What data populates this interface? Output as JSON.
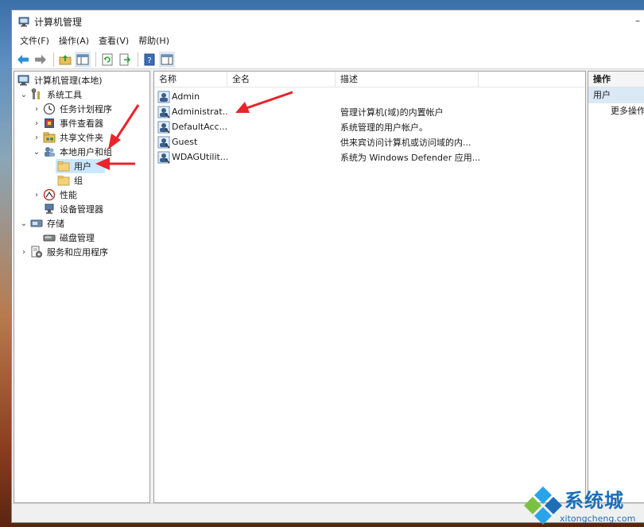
{
  "window": {
    "title": "计算机管理"
  },
  "menu": [
    "文件(F)",
    "操作(A)",
    "查看(V)",
    "帮助(H)"
  ],
  "toolbar": {
    "icons": [
      "back-arrow-icon",
      "forward-arrow-icon",
      "up-folder-icon",
      "show-hide-tree-icon",
      "refresh-icon",
      "export-icon",
      "help-icon",
      "show-action-pane-icon"
    ]
  },
  "tree": {
    "root": "计算机管理(本地)",
    "system_tools": "系统工具",
    "task_scheduler": "任务计划程序",
    "event_viewer": "事件查看器",
    "shared_folders": "共享文件夹",
    "local_users_groups": "本地用户和组",
    "users": "用户",
    "groups": "组",
    "performance": "性能",
    "device_manager": "设备管理器",
    "storage": "存储",
    "disk_management": "磁盘管理",
    "services_apps": "服务和应用程序"
  },
  "list": {
    "columns": [
      "名称",
      "全名",
      "描述"
    ],
    "rows": [
      {
        "name": "Admin",
        "full": "",
        "desc": ""
      },
      {
        "name": "Administrat...",
        "full": "",
        "desc": "管理计算机(域)的内置帐户"
      },
      {
        "name": "DefaultAcc...",
        "full": "",
        "desc": "系统管理的用户帐户。"
      },
      {
        "name": "Guest",
        "full": "",
        "desc": "供来宾访问计算机或访问域的内..."
      },
      {
        "name": "WDAGUtilit...",
        "full": "",
        "desc": "系统为 Windows Defender 应用..."
      }
    ]
  },
  "actions": {
    "header": "操作",
    "section": "用户",
    "more": "更多操作"
  },
  "watermark": {
    "brand": "系统城",
    "site": "xitongcheng.com"
  },
  "colors": {
    "selection": "#cce8ff",
    "annotation_arrow": "#e8242a",
    "brand": "#1d6fb8"
  }
}
